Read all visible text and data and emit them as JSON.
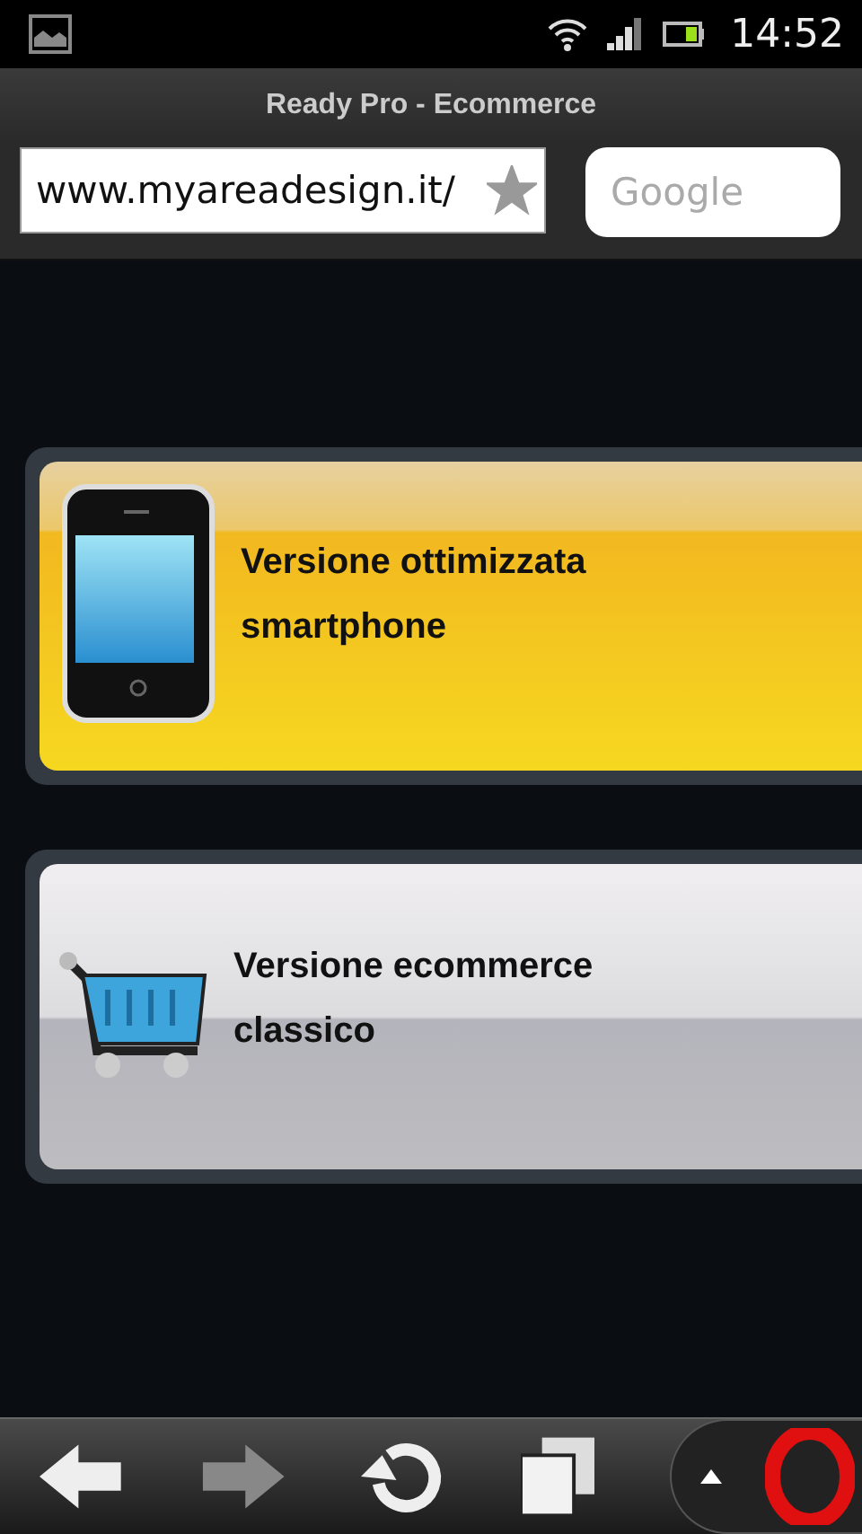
{
  "status_bar": {
    "time": "14:52"
  },
  "window": {
    "title": "Ready Pro - Ecommerce"
  },
  "address_bar": {
    "url": "www.myareadesign.it/",
    "bookmarked": true
  },
  "search": {
    "placeholder": "Google"
  },
  "options": [
    {
      "kind": "smartphone",
      "label": "Versione  ottimizzata smartphone"
    },
    {
      "kind": "cart",
      "label": "Versione  ecommerce classico"
    }
  ]
}
